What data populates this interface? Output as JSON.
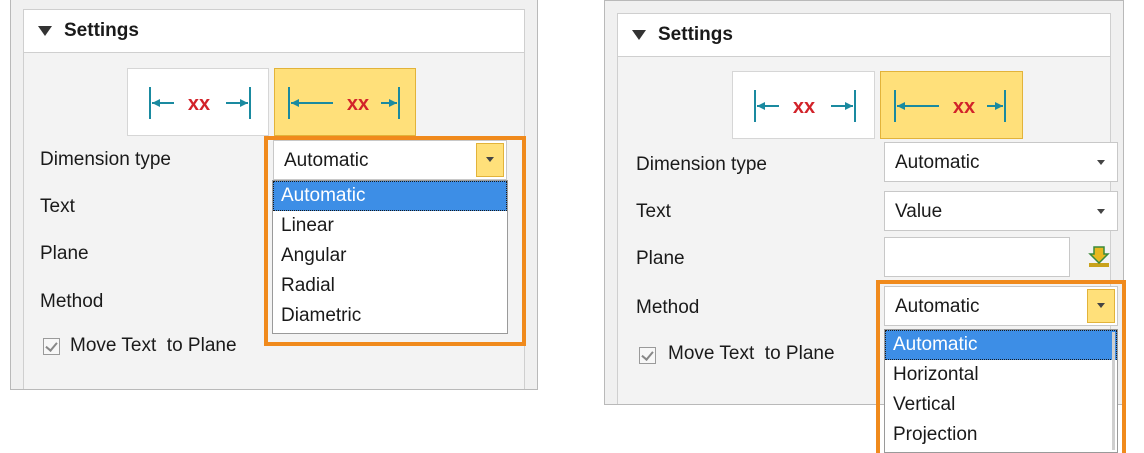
{
  "left_panel": {
    "title": "Settings",
    "dim_button_text": [
      "xx",
      "xx"
    ],
    "rows": {
      "dimension_type": {
        "label": "Dimension type",
        "value": "Automatic"
      },
      "text": {
        "label": "Text"
      },
      "plane": {
        "label": "Plane"
      },
      "method": {
        "label": "Method"
      }
    },
    "checkbox_label": "Move Text  to Plane",
    "dropdown_options": [
      "Automatic",
      "Linear",
      "Angular",
      "Radial",
      "Diametric"
    ],
    "dropdown_selected": "Automatic"
  },
  "right_panel": {
    "title": "Settings",
    "dim_button_text": [
      "xx",
      "xx"
    ],
    "rows": {
      "dimension_type": {
        "label": "Dimension type",
        "value": "Automatic"
      },
      "text": {
        "label": "Text",
        "value": "Value"
      },
      "plane": {
        "label": "Plane",
        "value": ""
      },
      "method": {
        "label": "Method",
        "value": "Automatic"
      }
    },
    "checkbox_label": "Move Text  to Plane",
    "dropdown_options": [
      "Automatic",
      "Horizontal",
      "Vertical",
      "Projection"
    ],
    "dropdown_selected": "Automatic"
  },
  "colors": {
    "highlight": "#f08a1c",
    "active_button": "#ffe07a",
    "selection": "#3d8ee6",
    "dimension_text": "#d2232a",
    "dimension_line": "#1a8aa0"
  }
}
